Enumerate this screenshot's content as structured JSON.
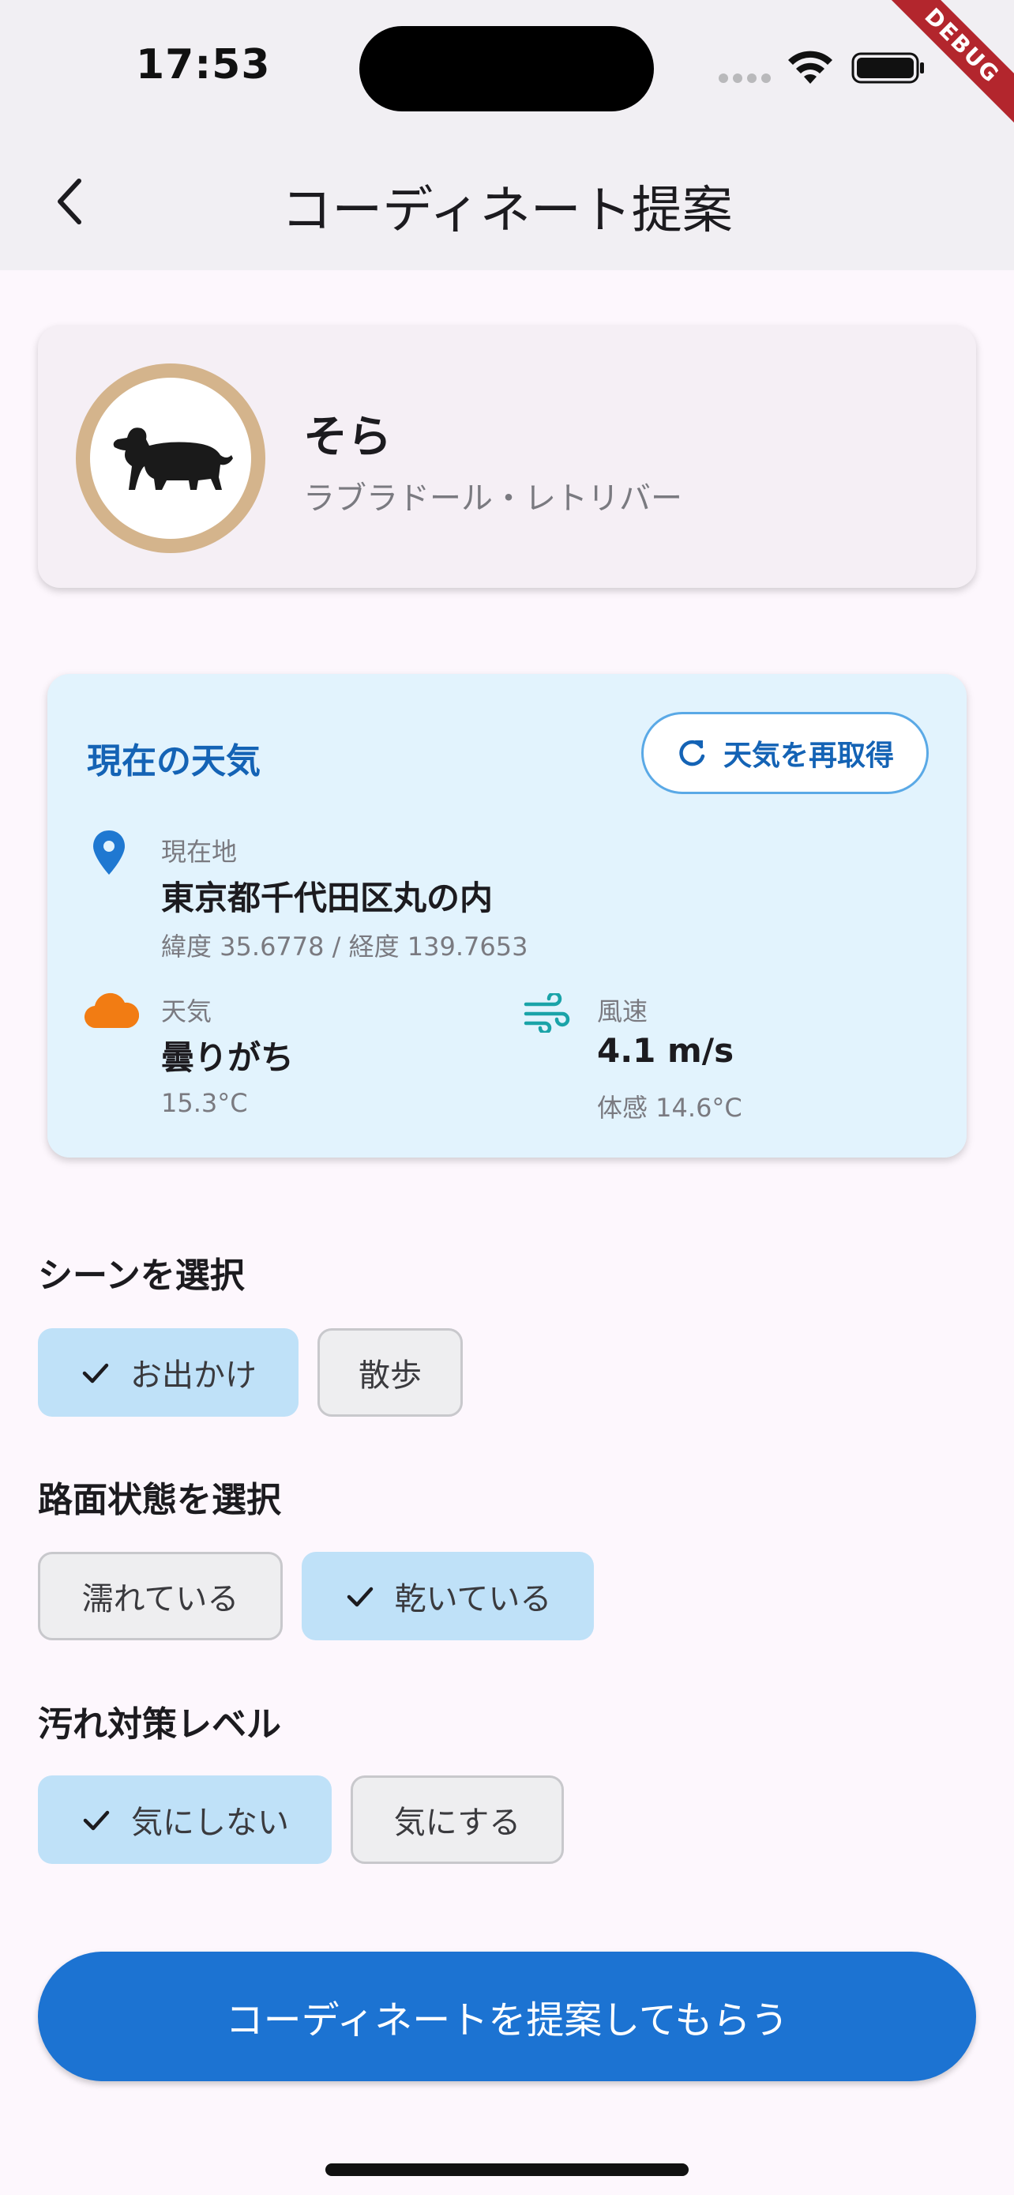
{
  "status_bar": {
    "time": "17:53",
    "debug_label": "DEBUG"
  },
  "app_bar": {
    "title": "コーディネート提案"
  },
  "pet": {
    "name": "そら",
    "breed": "ラブラドール・レトリバー"
  },
  "weather": {
    "title": "現在の天気",
    "refresh_label": "天気を再取得",
    "location_caption": "現在地",
    "location": "東京都千代田区丸の内",
    "coords": "緯度 35.6778 / 経度 139.7653",
    "condition_caption": "天気",
    "condition": "曇りがち",
    "temperature": "15.3°C",
    "wind_caption": "風速",
    "wind_speed": "4.1 m/s",
    "feels_like": "体感 14.6°C"
  },
  "scene": {
    "label": "シーンを選択",
    "options": [
      {
        "label": "お出かけ",
        "selected": true
      },
      {
        "label": "散歩",
        "selected": false
      }
    ]
  },
  "road": {
    "label": "路面状態を選択",
    "options": [
      {
        "label": "濡れている",
        "selected": false
      },
      {
        "label": "乾いている",
        "selected": true
      }
    ]
  },
  "dirt": {
    "label": "汚れ対策レベル",
    "options": [
      {
        "label": "気にしない",
        "selected": true
      },
      {
        "label": "気にする",
        "selected": false
      }
    ]
  },
  "cta": {
    "label": "コーディネートを提案してもらう"
  },
  "colors": {
    "primary": "#1c73d2",
    "selected_chip": "#bfe1f8",
    "weather_bg": "#e2f3fd",
    "avatar_ring": "#d4b48c"
  }
}
